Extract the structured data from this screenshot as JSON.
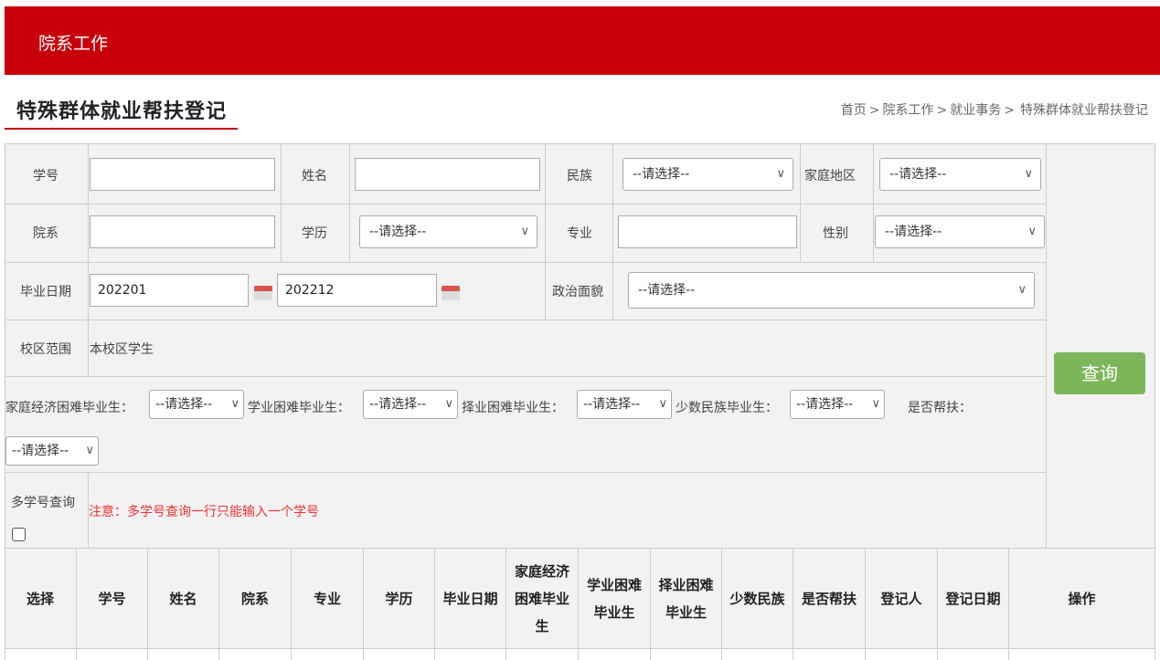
{
  "header": {
    "title": "院系工作"
  },
  "page": {
    "title": "特殊群体就业帮扶登记",
    "breadcrumb": [
      "首页",
      "院系工作",
      "就业事务",
      "特殊群体就业帮扶登记"
    ],
    "breadcrumb_sep": ">"
  },
  "form": {
    "student_id_label": "学号",
    "name_label": "姓名",
    "ethnicity_label": "民族",
    "home_region_label": "家庭地区",
    "department_label": "院系",
    "education_label": "学历",
    "major_label": "专业",
    "gender_label": "性别",
    "grad_date_label": "毕业日期",
    "grad_date_from": "202201",
    "grad_date_to": "202212",
    "politics_label": "政治面貌",
    "campus_label": "校区范围",
    "campus_value": "本校区学生",
    "econ_label": "家庭经济困难毕业生：",
    "study_label": "学业困难毕业生：",
    "job_label": "择业困难毕业生：",
    "minority_label": "少数民族毕业生：",
    "assisted_label": "是否帮扶：",
    "multi_label": "多学号查询",
    "multi_note": "注意：多学号查询一行只能输入一个学号",
    "placeholder_select": "--请选择--",
    "query_button": "查询"
  },
  "table": {
    "headers": [
      "选择",
      "学号",
      "姓名",
      "院系",
      "专业",
      "学历",
      "毕业日期",
      "家庭经济困难毕业生",
      "学业困难毕业生",
      "择业困难毕业生",
      "少数民族",
      "是否帮扶",
      "登记人",
      "登记日期",
      "操作"
    ]
  },
  "colors": {
    "brand_red": "#c8000b",
    "query_green": "#7cb65a",
    "note_red": "#e33333"
  },
  "icons": {
    "select_arrow": "chevron-down-icon",
    "date_picker": "calendar-icon"
  }
}
